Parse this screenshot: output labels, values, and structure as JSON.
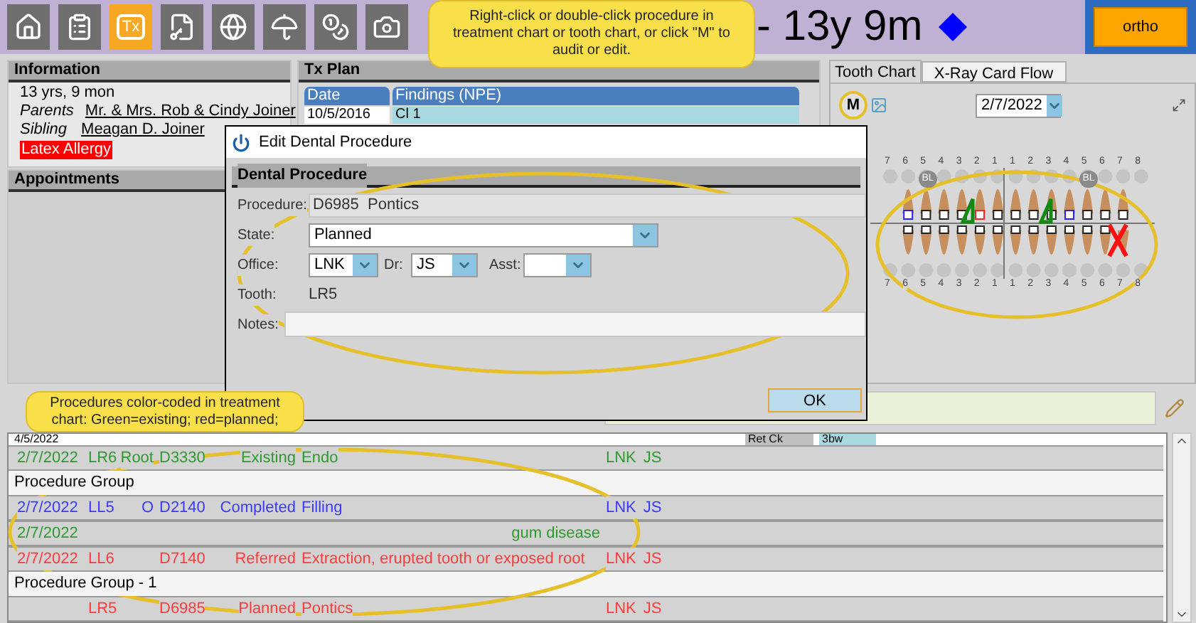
{
  "toolbar": [
    {
      "kind": "home",
      "selected": false
    },
    {
      "kind": "checklist",
      "selected": false
    },
    {
      "kind": "text",
      "label": "Tx",
      "selected": true
    },
    {
      "kind": "document",
      "selected": false
    },
    {
      "kind": "globe",
      "selected": false
    },
    {
      "kind": "umbrella",
      "selected": false
    },
    {
      "kind": "coins",
      "selected": false
    },
    {
      "kind": "camera",
      "selected": false
    }
  ],
  "patient_title": "- 13y 9m",
  "category_button": "ortho",
  "top_callout": "Right-click or double-click procedure in treatment chart or tooth chart, or click \"M\" to audit or edit.",
  "information": {
    "title": "Information",
    "age": "13 yrs, 9 mon",
    "parents_label": "Parents",
    "parents": "Mr. & Mrs. Rob & Cindy Joiner",
    "sibling_label": "Sibling",
    "sibling": "Meagan D. Joiner",
    "alert": "Latex Allergy"
  },
  "appointments": {
    "title": "Appointments"
  },
  "tx_plan": {
    "title": "Tx Plan",
    "columns": [
      "Date",
      "Findings (NPE)"
    ],
    "rows": [
      [
        "10/5/2016",
        "Cl 1"
      ]
    ]
  },
  "chart_tabs": [
    {
      "label": "Tooth Chart",
      "selected": true
    },
    {
      "label": "X-Ray Card Flow",
      "selected": false
    }
  ],
  "tooth_chart": {
    "audit_button": "M",
    "date": "2/7/2022",
    "upper_numbers": [
      "7",
      "6",
      "5",
      "4",
      "3",
      "2",
      "1",
      "1",
      "2",
      "3",
      "4",
      "5",
      "6",
      "7",
      "8"
    ],
    "lower_numbers": [
      "7",
      "6",
      "5",
      "4",
      "3",
      "2",
      "1",
      "1",
      "2",
      "3",
      "4",
      "5",
      "6",
      "7",
      "8"
    ],
    "badges": [
      "BL",
      "BL"
    ]
  },
  "dialog": {
    "title": "Edit Dental Procedure",
    "section": "Dental Procedure",
    "procedure_label": "Procedure:",
    "procedure": "D6985  Pontics",
    "state_label": "State:",
    "state": "Planned",
    "office_label": "Office:",
    "office": "LNK",
    "dr_label": "Dr:",
    "dr": "JS",
    "asst_label": "Asst:",
    "tooth_label": "Tooth:",
    "tooth": "LR5",
    "notes_label": "Notes:",
    "ok": "OK"
  },
  "bottom_callout": "Procedures color-coded in treatment chart: Green=existing; red=planned;",
  "previous_row": {
    "date": "4/5/2022",
    "cells": [
      "Ret Ck",
      "3bw"
    ]
  },
  "procedures": [
    {
      "kind": "procedure",
      "color": "#2e9a2e",
      "date": "2/7/2022",
      "tooth": "LR6",
      "surface": "Root",
      "code": "D3330",
      "status": "Existing",
      "description": "Endo",
      "office": "LNK",
      "dr": "JS"
    },
    {
      "kind": "group",
      "label": "Procedure Group"
    },
    {
      "kind": "procedure",
      "color": "#3a3aff",
      "date": "2/7/2022",
      "tooth": "LL5",
      "surface": "O",
      "code": "D2140",
      "status": "Completed",
      "description": "Filling",
      "office": "LNK",
      "dr": "JS"
    },
    {
      "kind": "finding",
      "color": "#2e9a2e",
      "date": "2/7/2022",
      "note": "gum disease"
    },
    {
      "kind": "procedure",
      "color": "#ff3b3b",
      "date": "2/7/2022",
      "tooth": "LL6",
      "code": "D7140",
      "status": "Referred",
      "description": "Extraction, erupted tooth or exposed root",
      "office": "LNK",
      "dr": "JS"
    },
    {
      "kind": "group",
      "label": "Procedure Group - 1"
    },
    {
      "kind": "procedure",
      "color": "#ff3b3b",
      "tooth": "LR5",
      "code": "D6985",
      "status": "Planned",
      "description": "Pontics",
      "office": "LNK",
      "dr": "JS"
    }
  ]
}
